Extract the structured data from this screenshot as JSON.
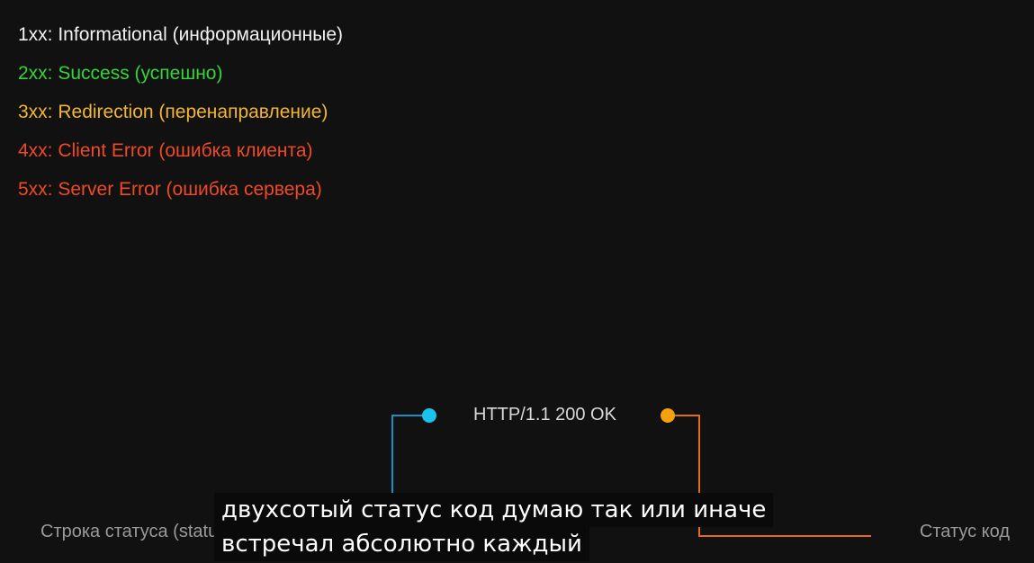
{
  "status_classes": [
    {
      "text": "1xx: Informational (информационные)",
      "color": "#f2f2f2"
    },
    {
      "text": "2xx: Success (успешно)",
      "color": "#35d43a"
    },
    {
      "text": "3xx: Redirection (перенаправление)",
      "color": "#f2b632"
    },
    {
      "text": "4xx: Client Error (ошибка клиента)",
      "color": "#ee4a27"
    },
    {
      "text": "5xx: Server Error (ошибка сервера)",
      "color": "#ee4a27"
    }
  ],
  "diagram": {
    "status_line": "HTTP/1.1 200 OK",
    "left_label": "Строка статуса (status line)",
    "right_label": "Статус код",
    "left_marker_color": "#19c3ec",
    "right_marker_color": "#f5a00d",
    "left_connector_color": "#1a8fc7",
    "right_connector_color": "#e46b14"
  },
  "subtitles": {
    "line1": "двухсотый статус код думаю так или иначе",
    "line2": "встречал абсолютно каждый"
  }
}
